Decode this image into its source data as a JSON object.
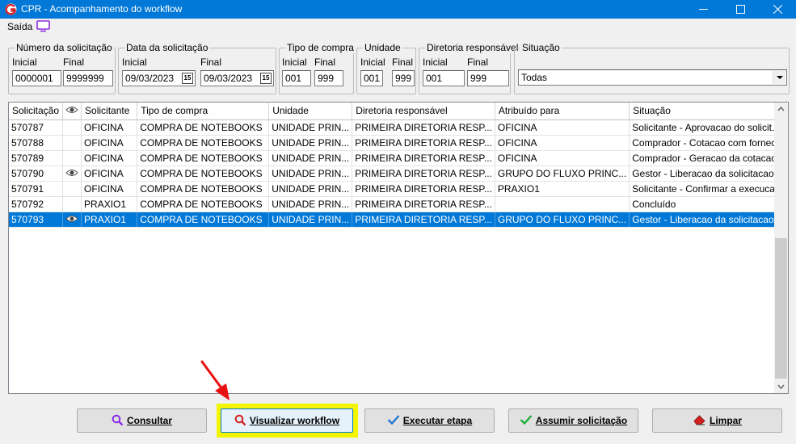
{
  "window": {
    "title": "CPR - Acompanhamento do workflow",
    "minimize_icon": "minimize-icon",
    "maximize_icon": "maximize-icon",
    "close_icon": "close-icon"
  },
  "menu": {
    "exit_label": "Saída",
    "monitor_icon": "monitor-icon"
  },
  "filters": {
    "request_number": {
      "title": "Número da solicitação",
      "initial_label": "Inicial",
      "final_label": "Final",
      "initial_value": "0000001",
      "final_value": "9999999"
    },
    "request_date": {
      "title": "Data da solicitação",
      "initial_label": "Inicial",
      "final_label": "Final",
      "initial_value": "09/03/2023",
      "final_value": "09/03/2023",
      "calendar_icon_text": "15"
    },
    "purchase_type": {
      "title": "Tipo de compra",
      "initial_label": "Inicial",
      "final_label": "Final",
      "initial_value": "001",
      "final_value": "999"
    },
    "unit": {
      "title": "Unidade",
      "initial_label": "Inicial",
      "final_label": "Final",
      "initial_value": "001",
      "final_value": "999"
    },
    "directorate": {
      "title": "Diretoria responsável",
      "initial_label": "Inicial",
      "final_label": "Final",
      "initial_value": "001",
      "final_value": "999"
    },
    "status": {
      "title": "Situação",
      "selected": "Todas"
    }
  },
  "grid": {
    "columns": [
      "Solicitação",
      "eye-icon",
      "Solicitante",
      "Tipo de compra",
      "Unidade",
      "Diretoria responsável",
      "Atribuído para",
      "Situação"
    ],
    "rows": [
      {
        "id": "570787",
        "viewed": false,
        "requester": "OFICINA",
        "type": "COMPRA DE NOTEBOOKS",
        "unit": "UNIDADE PRIN...",
        "directorate": "PRIMEIRA DIRETORIA RESP...",
        "assigned": "OFICINA",
        "status": "Solicitante - Aprovacao do solicit..."
      },
      {
        "id": "570788",
        "viewed": false,
        "requester": "OFICINA",
        "type": "COMPRA DE NOTEBOOKS",
        "unit": "UNIDADE PRIN...",
        "directorate": "PRIMEIRA DIRETORIA RESP...",
        "assigned": "OFICINA",
        "status": "Comprador - Cotacao com fornec..."
      },
      {
        "id": "570789",
        "viewed": false,
        "requester": "OFICINA",
        "type": "COMPRA DE NOTEBOOKS",
        "unit": "UNIDADE PRIN...",
        "directorate": "PRIMEIRA DIRETORIA RESP...",
        "assigned": "OFICINA",
        "status": "Comprador - Geracao da cotacao"
      },
      {
        "id": "570790",
        "viewed": true,
        "requester": "OFICINA",
        "type": "COMPRA DE NOTEBOOKS",
        "unit": "UNIDADE PRIN...",
        "directorate": "PRIMEIRA DIRETORIA RESP...",
        "assigned": "GRUPO DO FLUXO PRINC...",
        "status": "Gestor - Liberacao da solicitacao ..."
      },
      {
        "id": "570791",
        "viewed": false,
        "requester": "OFICINA",
        "type": "COMPRA DE NOTEBOOKS",
        "unit": "UNIDADE PRIN...",
        "directorate": "PRIMEIRA DIRETORIA RESP...",
        "assigned": "PRAXIO1",
        "status": "Solicitante - Confirmar a execuca..."
      },
      {
        "id": "570792",
        "viewed": false,
        "requester": "PRAXIO1",
        "type": "COMPRA DE NOTEBOOKS",
        "unit": "UNIDADE PRIN...",
        "directorate": "PRIMEIRA DIRETORIA RESP...",
        "assigned": "",
        "status": "Concluído"
      },
      {
        "id": "570793",
        "viewed": true,
        "requester": "PRAXIO1",
        "type": "COMPRA DE NOTEBOOKS",
        "unit": "UNIDADE PRIN...",
        "directorate": "PRIMEIRA DIRETORIA RESP...",
        "assigned": "GRUPO DO FLUXO PRINC...",
        "status": "Gestor - Liberacao da solicitacao ...",
        "selected": true
      }
    ]
  },
  "buttons": {
    "consult": "Consultar",
    "view_workflow": "Visualizar workflow",
    "execute_step": "Executar etapa",
    "assume_request": "Assumir solicitação",
    "clear": "Limpar"
  },
  "colors": {
    "titlebar": "#0078d7",
    "selection": "#0078d7",
    "highlight": "#f4f500",
    "annotation_arrow": "#e81010"
  }
}
